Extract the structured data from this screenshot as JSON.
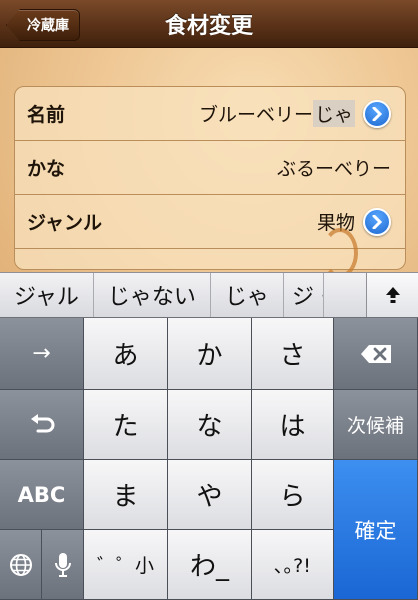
{
  "navbar": {
    "back_label": "冷蔵庫",
    "title": "食材変更"
  },
  "form": {
    "rows": [
      {
        "label": "名前",
        "value_prefix": "ブルーベリー",
        "value_composing": "じゃ",
        "has_disclosure": true
      },
      {
        "label": "かな",
        "value": "ぶるーべりー",
        "has_disclosure": false
      },
      {
        "label": "ジャンル",
        "value": "果物",
        "has_disclosure": true
      }
    ]
  },
  "candidates": {
    "items": [
      "ジャル",
      "じゃない",
      "じゃ",
      "ジ・"
    ],
    "expand_icon": "up-arrow-icon"
  },
  "keyboard": {
    "row1": [
      "→",
      "あ",
      "か",
      "さ"
    ],
    "row2": [
      "た",
      "な",
      "は",
      "次候補"
    ],
    "row3": [
      "ABC",
      "ま",
      "や",
      "ら",
      "確定"
    ],
    "row4": [
      "゛゜小",
      "わ_",
      "､｡?!"
    ],
    "icons": [
      "backspace-icon",
      "undo-icon",
      "globe-icon",
      "microphone-icon"
    ],
    "colors": {
      "enter": "#1a66d4",
      "function": "#6c727c",
      "letter": "#f7f7f8"
    }
  }
}
